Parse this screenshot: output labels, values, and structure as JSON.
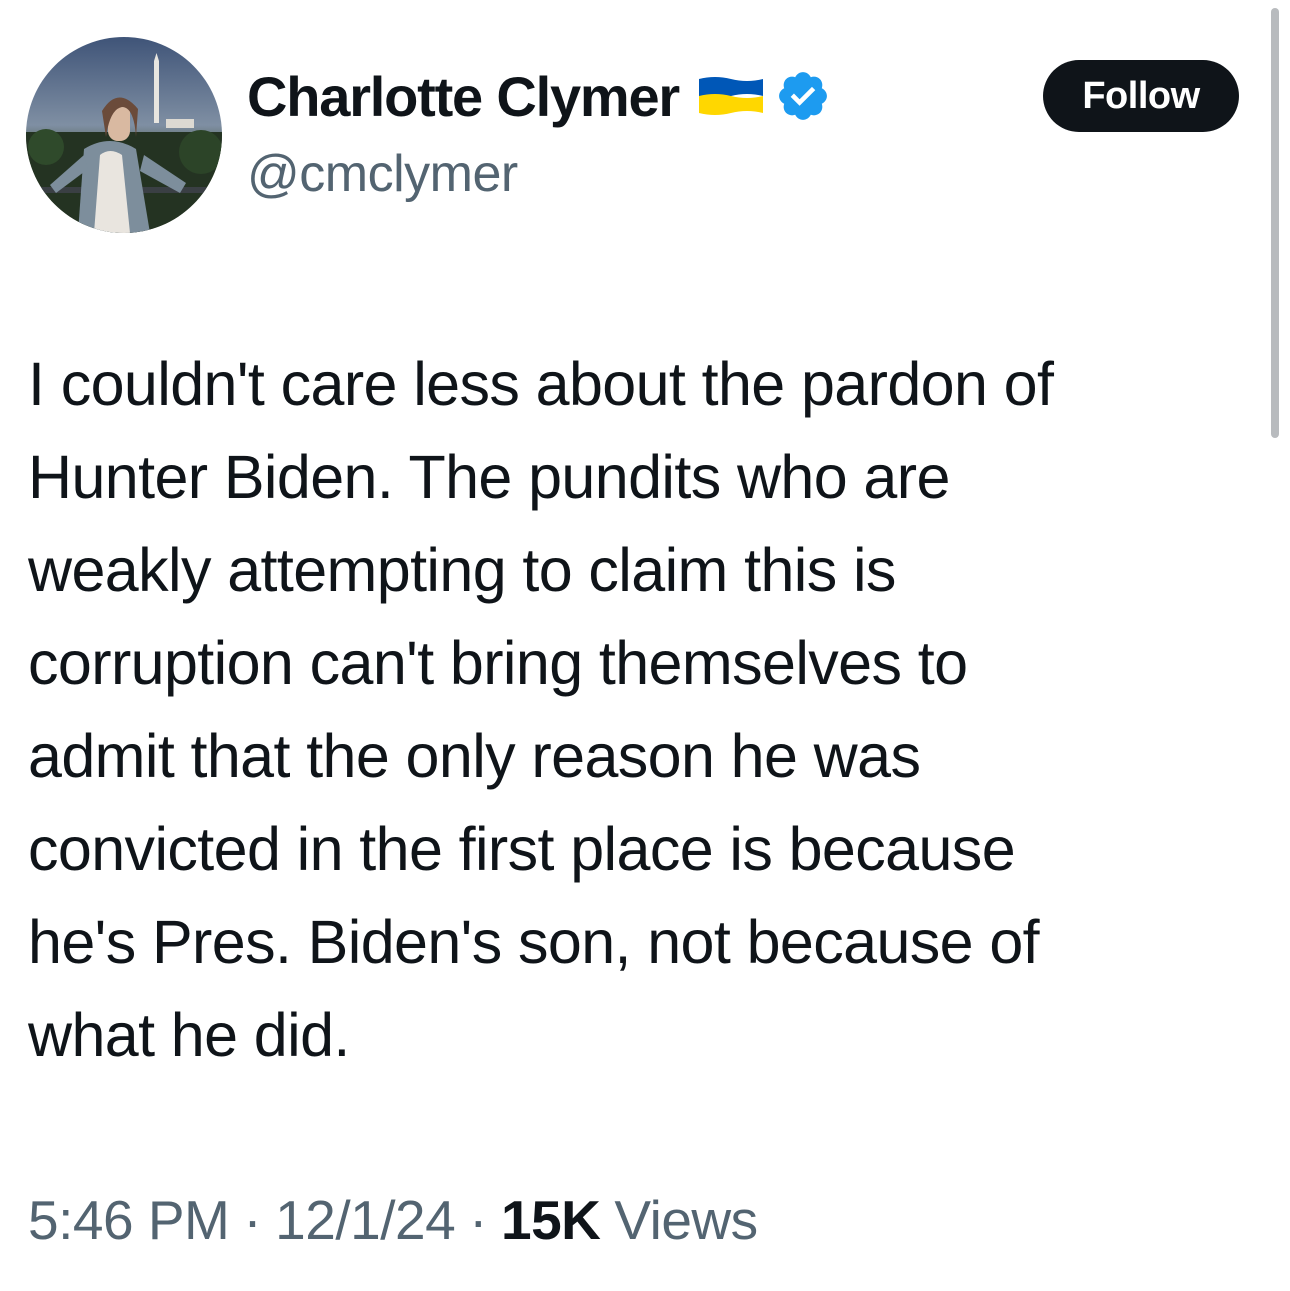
{
  "author": {
    "display_name": "Charlotte Clymer",
    "handle": "@cmclymer",
    "badge_flag": "ukraine-flag-icon",
    "verified_badge": "verified-check-icon"
  },
  "actions": {
    "follow_label": "Follow"
  },
  "tweet": {
    "lines": [
      "I couldn't care less about the pardon of",
      "Hunter Biden. The pundits who are",
      "weakly attempting to claim this is",
      "corruption can't bring themselves to",
      "admit that the only reason he was",
      "convicted in the first place is because",
      "he's Pres. Biden's son, not because of",
      "what he did."
    ]
  },
  "meta": {
    "time": "5:46 PM",
    "separator": "·",
    "date": "12/1/24",
    "views_count": "15K",
    "views_label": "Views"
  },
  "colors": {
    "text_primary": "#0f1419",
    "text_secondary": "#536471",
    "verified_blue": "#1d9bf0",
    "flag_blue": "#0057b7",
    "flag_yellow": "#ffd700"
  }
}
